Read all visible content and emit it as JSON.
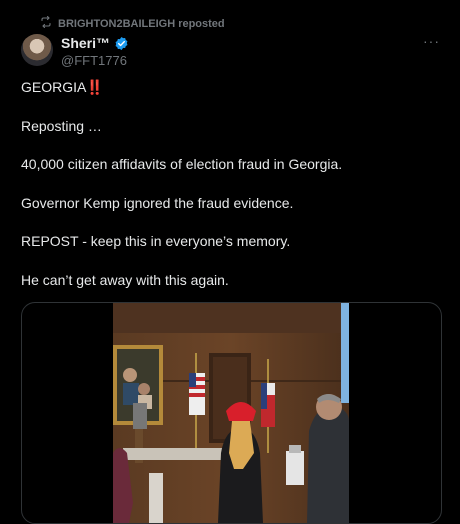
{
  "repost": {
    "label": "BRIGHTON2BAILEIGH reposted",
    "icon": "repost-icon"
  },
  "author": {
    "name": "Sheri™",
    "handle": "@FFT1776",
    "verified_icon": "verified-badge-icon",
    "verified_color": "#1d9bf0"
  },
  "more_label": "···",
  "tweet": {
    "line1": "GEORGIA",
    "line1_emoji": "‼️",
    "line2": "Reposting …",
    "line3": "40,000 citizen affidavits of election fraud in Georgia.",
    "line4": "Governor Kemp ignored the fraud evidence.",
    "line5": "REPOST - keep this in everyone’s memory.",
    "line6": "He can’t get away with this again."
  },
  "colors": {
    "background": "#000000",
    "text": "#e7e9ea",
    "muted": "#71767b",
    "border": "#2f3336",
    "alarm": "#f4212e"
  }
}
